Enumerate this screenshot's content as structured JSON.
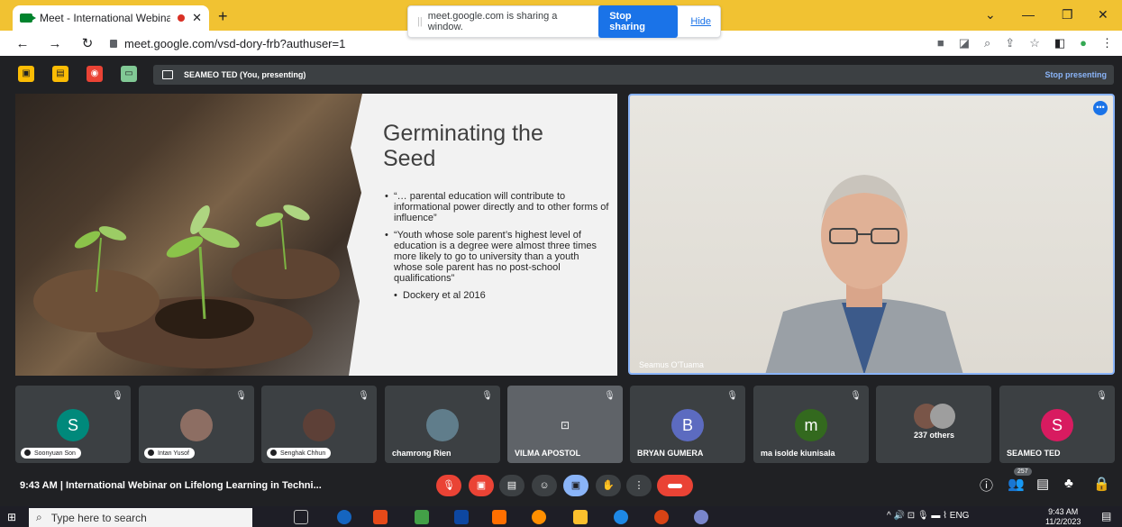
{
  "browser": {
    "tab_title": "Meet - International Webina",
    "url": "meet.google.com/vsd-dory-frb?authuser=1",
    "share_message": "meet.google.com is sharing a window.",
    "stop_sharing": "Stop sharing",
    "hide": "Hide"
  },
  "meet": {
    "presenting_label": "SEAMEO TED (You, presenting)",
    "stop_presenting": "Stop presenting",
    "slide": {
      "title": "Germinating the Seed",
      "bullets": [
        "“… parental education will contribute to informational power directly and to other forms of influence”",
        "“Youth whose sole parent’s highest level of education is a degree were almost three times more likely to go to university than a youth whose sole parent has no post-school qualifications”",
        "Dockery et al 2016"
      ]
    },
    "speaker_name": "Seamus O'Tuama",
    "participants": [
      {
        "name": "Soonyuan Son",
        "initial": "S",
        "color": "#00897b"
      },
      {
        "name": "Intan Yusof",
        "initial": "",
        "color": "#8d6e63"
      },
      {
        "name": "Senghak Chhun",
        "initial": "",
        "color": "#5d4037"
      },
      {
        "name": "chamrong Rien",
        "initial": "",
        "color": "#607d8b"
      },
      {
        "name": "VILMA APOSTOL",
        "initial": "",
        "color": "#5f6368"
      },
      {
        "name": "BRYAN GUMERA",
        "initial": "B",
        "color": "#5c6bc0"
      },
      {
        "name": "ma isolde kiunisala",
        "initial": "m",
        "color": "#33691e"
      },
      {
        "name": "237 others",
        "initial": "",
        "color": "#795548"
      },
      {
        "name": "SEAMEO TED",
        "initial": "S",
        "color": "#d81b60"
      }
    ],
    "time": "9:43 AM",
    "meeting_title": "International Webinar on Lifelong Learning in Techni...",
    "participant_count": "257"
  },
  "taskbar": {
    "search_placeholder": "Type here to search",
    "lang": "ENG",
    "time": "9:43 AM",
    "date": "11/2/2023"
  }
}
